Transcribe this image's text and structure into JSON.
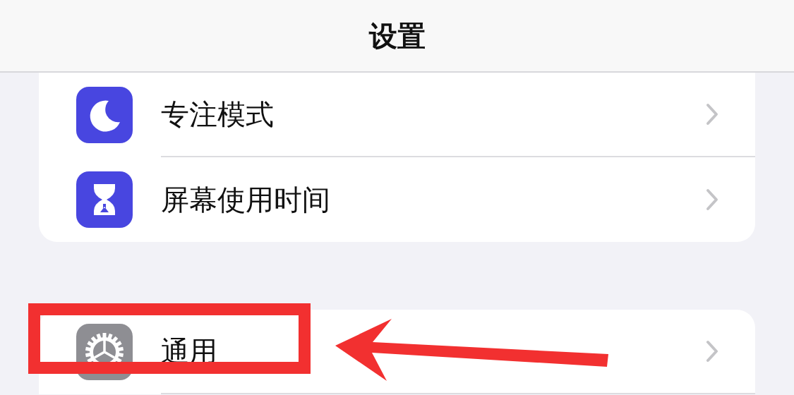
{
  "navigation_bar": {
    "title": "设置"
  },
  "groups": [
    {
      "items": [
        {
          "label": "专注模式",
          "kind": "moon",
          "color": "#4846e0"
        },
        {
          "label": "屏幕使用时间",
          "kind": "hourglass",
          "color": "#4846e0"
        }
      ]
    },
    {
      "items": [
        {
          "label": "通用",
          "kind": "gear",
          "color": "#8e8e93"
        }
      ]
    }
  ],
  "annotations": {
    "highlight_box": true,
    "arrow": true
  }
}
